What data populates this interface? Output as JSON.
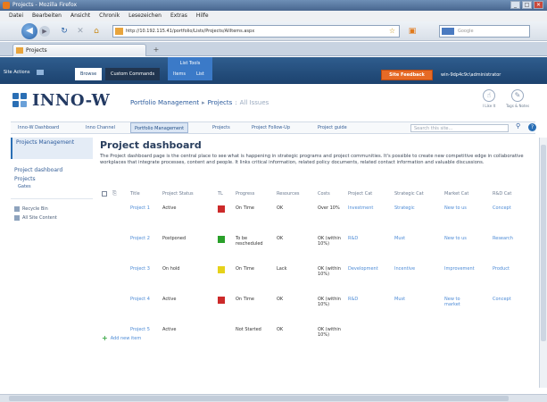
{
  "window": {
    "title": "Projects - Mozilla Firefox",
    "controls": [
      "_",
      "□",
      "✕"
    ]
  },
  "menu": [
    "Datei",
    "Bearbeiten",
    "Ansicht",
    "Chronik",
    "Lesezeichen",
    "Extras",
    "Hilfe"
  ],
  "browser": {
    "url": "http://10.192.115.41/portfolio/Lists/Projects/AllItems.aspx",
    "search_placeholder": "Google",
    "tab_title": "Projects"
  },
  "ribbon": {
    "site_actions": "Site Actions",
    "browse": "Browse",
    "custom_commands": "Custom Commands",
    "list_tools": "List Tools",
    "items": "Items",
    "list": "List",
    "site_feedback": "Site Feedback",
    "user": "win-9dp4c9c\\administrator"
  },
  "header": {
    "logo": "INNO-W",
    "breadcrumb": [
      "Portfolio Management",
      "Projects",
      "All Issues"
    ],
    "like_it": "I Like It",
    "tags_notes": "Tags & Notes"
  },
  "topnav": {
    "items": [
      "Inno-W Dashboard",
      "Inno Channel",
      "Portfolio Management",
      "Projects",
      "Project Follow-Up",
      "Project guide"
    ],
    "search_placeholder": "Search this site..."
  },
  "leftnav": {
    "selected": "Projects Management",
    "items": [
      "Project dashboard",
      "Projects"
    ],
    "sub": "Gates",
    "footer": [
      "Recycle Bin",
      "All Site Content"
    ]
  },
  "main": {
    "title": "Project  dashboard",
    "description": "The Project dashboard page is the central place to see what is happening in strategic programs and project communities. It's possible to create new competitive edge in collaborative workplaces that integrate processes, content and people. It links critical information, related policy documents, related contact information and valuable discussions."
  },
  "grid": {
    "columns": [
      "Title",
      "Project Status",
      "TL",
      "Progress",
      "Resources",
      "Costs",
      "Project Cat",
      "Strategic Cat",
      "Market Cat",
      "R&D Cat"
    ],
    "rows": [
      {
        "title": "Project 1",
        "status": "Active",
        "tl": "#cc2a2a",
        "progress": "On Time",
        "resources": "OK",
        "costs": "Over 10%",
        "project_cat": "Investment",
        "strategic_cat": "Strategic",
        "market_cat": "New to us",
        "rd_cat": "Concept"
      },
      {
        "title": "Project 2",
        "status": "Postponed",
        "tl": "#2aa02a",
        "progress": "To be rescheduled",
        "resources": "OK",
        "costs": "OK (within 10%)",
        "project_cat": "R&D",
        "strategic_cat": "Must",
        "market_cat": "New to us",
        "rd_cat": "Research"
      },
      {
        "title": "Project 3",
        "status": "On hold",
        "tl": "#e6d21a",
        "progress": "On Time",
        "resources": "Lack",
        "costs": "OK (within 10%)",
        "project_cat": "Development",
        "strategic_cat": "Incentive",
        "market_cat": "Improvement",
        "rd_cat": "Product"
      },
      {
        "title": "Project 4",
        "status": "Active",
        "tl": "#cc2a2a",
        "progress": "On Time",
        "resources": "OK",
        "costs": "OK (within 10%)",
        "project_cat": "R&D",
        "strategic_cat": "Must",
        "market_cat": "New to market",
        "rd_cat": "Concept"
      },
      {
        "title": "Project 5",
        "status": "Active",
        "tl": "",
        "progress": "Not Started",
        "resources": "OK",
        "costs": "OK (within 10%)",
        "project_cat": "",
        "strategic_cat": "",
        "market_cat": "",
        "rd_cat": ""
      }
    ],
    "add_new": "Add new item"
  }
}
